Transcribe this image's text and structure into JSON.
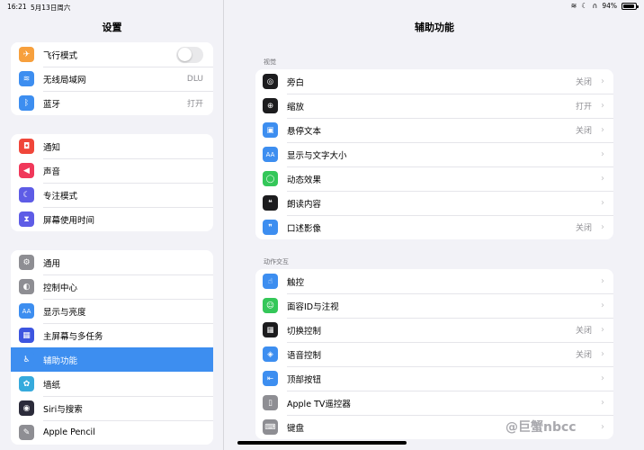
{
  "status": {
    "time": "16:21",
    "date": "5月13日周六",
    "battery": "94%",
    "battery_level": 0.94
  },
  "sidebar": {
    "title": "设置",
    "group1": [
      {
        "label": "飞行模式",
        "icon": "airplane-icon",
        "color": "#f7a03d",
        "toggle": false,
        "glyph": "✈"
      },
      {
        "label": "无线局域网",
        "icon": "wifi-icon",
        "color": "#3d8ef0",
        "value": "DLU",
        "glyph": "≋"
      },
      {
        "label": "蓝牙",
        "icon": "bluetooth-icon",
        "color": "#3d8ef0",
        "value": "打开",
        "glyph": "ᛒ"
      }
    ],
    "group2": [
      {
        "label": "通知",
        "icon": "notification-icon",
        "color": "#f0463a",
        "glyph": "◘"
      },
      {
        "label": "声音",
        "icon": "speaker-icon",
        "color": "#f0385a",
        "glyph": "◀"
      },
      {
        "label": "专注模式",
        "icon": "moon-icon",
        "color": "#5e5ce6",
        "glyph": "☾"
      },
      {
        "label": "屏幕使用时间",
        "icon": "hourglass-icon",
        "color": "#5e5ce6",
        "glyph": "⧗"
      }
    ],
    "group3": [
      {
        "label": "通用",
        "icon": "gear-icon",
        "color": "#8e8e93",
        "glyph": "⚙"
      },
      {
        "label": "控制中心",
        "icon": "control-center-icon",
        "color": "#8e8e93",
        "glyph": "◐"
      },
      {
        "label": "显示与亮度",
        "icon": "display-icon",
        "color": "#3d8ef0",
        "glyph": "AA"
      },
      {
        "label": "主屏幕与多任务",
        "icon": "home-screen-icon",
        "color": "#3d55e0",
        "glyph": "▦"
      },
      {
        "label": "辅助功能",
        "icon": "accessibility-icon",
        "color": "#3d8ef0",
        "glyph": "♿",
        "active": true
      },
      {
        "label": "墙纸",
        "icon": "wallpaper-icon",
        "color": "#36aadc",
        "glyph": "✿"
      },
      {
        "label": "Siri与搜索",
        "icon": "siri-icon",
        "color": "#2b2b3a",
        "glyph": "◉"
      },
      {
        "label": "Apple Pencil",
        "icon": "pencil-icon",
        "color": "#8e8e93",
        "glyph": "✎"
      }
    ]
  },
  "main": {
    "title": "辅助功能",
    "vision_header": "视觉",
    "vision": [
      {
        "label": "旁白",
        "icon": "voiceover-icon",
        "color": "#1c1c1e",
        "value": "关闭",
        "glyph": "◎"
      },
      {
        "label": "缩放",
        "icon": "zoom-icon",
        "color": "#1c1c1e",
        "value": "打开",
        "glyph": "⊕"
      },
      {
        "label": "悬停文本",
        "icon": "hover-text-icon",
        "color": "#3d8ef0",
        "value": "关闭",
        "glyph": "▣"
      },
      {
        "label": "显示与文字大小",
        "icon": "text-size-icon",
        "color": "#3d8ef0",
        "value": "",
        "glyph": "AA"
      },
      {
        "label": "动态效果",
        "icon": "motion-icon",
        "color": "#34c759",
        "value": "",
        "glyph": "◯"
      },
      {
        "label": "朗读内容",
        "icon": "spoken-content-icon",
        "color": "#1c1c1e",
        "value": "",
        "glyph": "❝"
      },
      {
        "label": "口述影像",
        "icon": "audio-description-icon",
        "color": "#3d8ef0",
        "value": "关闭",
        "glyph": "❞"
      }
    ],
    "physical_header": "动作交互",
    "physical": [
      {
        "label": "触控",
        "icon": "touch-icon",
        "color": "#3d8ef0",
        "value": "",
        "glyph": "☝"
      },
      {
        "label": "面容ID与注视",
        "icon": "face-id-icon",
        "color": "#34c759",
        "value": "",
        "glyph": "☺"
      },
      {
        "label": "切换控制",
        "icon": "switch-control-icon",
        "color": "#1c1c1e",
        "value": "关闭",
        "glyph": "▦"
      },
      {
        "label": "语音控制",
        "icon": "voice-control-icon",
        "color": "#3d8ef0",
        "value": "关闭",
        "glyph": "◈"
      },
      {
        "label": "顶部按钮",
        "icon": "top-button-icon",
        "color": "#3d8ef0",
        "value": "",
        "glyph": "⇤"
      },
      {
        "label": "Apple TV遥控器",
        "icon": "remote-icon",
        "color": "#8e8e93",
        "value": "",
        "glyph": "▯"
      },
      {
        "label": "键盘",
        "icon": "keyboard-icon",
        "color": "#8e8e93",
        "value": "",
        "glyph": "⌨"
      }
    ]
  },
  "watermark": "@巨蟹nbcc"
}
